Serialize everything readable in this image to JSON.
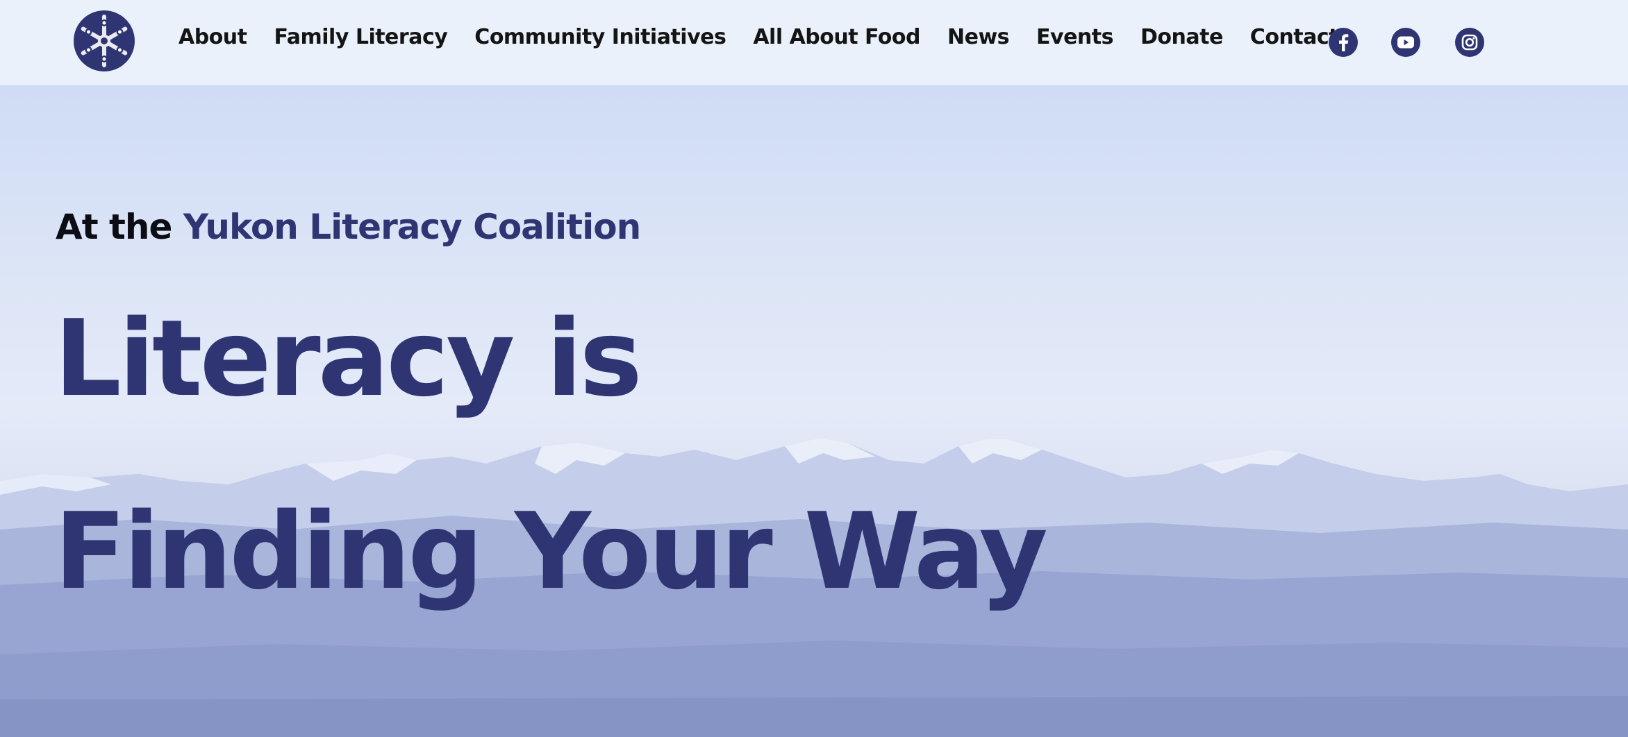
{
  "header": {
    "logo_icon": "snowflake-logo-icon",
    "nav": [
      {
        "label": "About"
      },
      {
        "label": "Family Literacy"
      },
      {
        "label": "Community Initiatives"
      },
      {
        "label": "All About Food"
      },
      {
        "label": "News"
      },
      {
        "label": "Events"
      },
      {
        "label": "Donate"
      },
      {
        "label": "Contact"
      }
    ],
    "social": [
      {
        "icon": "facebook-icon"
      },
      {
        "icon": "youtube-icon"
      },
      {
        "icon": "instagram-icon"
      }
    ]
  },
  "hero": {
    "eyebrow_lead": "At the",
    "eyebrow_org": "Yukon Literacy Coalition",
    "headline_line1": "Literacy is",
    "headline_line2": "Finding Your Way",
    "background": "snowy-mountains-photo"
  },
  "colors": {
    "brand": "#2e3572",
    "header_bg": "#eaf1fb",
    "text_dark": "#141414"
  }
}
